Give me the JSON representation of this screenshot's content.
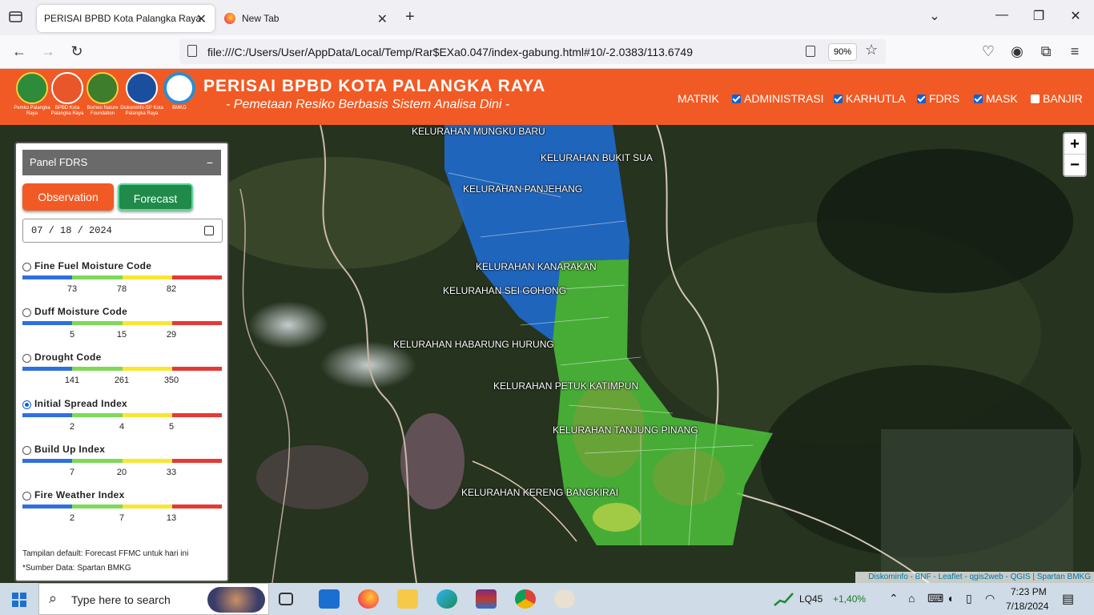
{
  "browser": {
    "tabs": [
      {
        "label": "PERISAI BPBD Kota Palangka Raya",
        "active": true
      },
      {
        "label": "New Tab",
        "active": false
      }
    ],
    "url": "file:///C:/Users/User/AppData/Local/Temp/Rar$EXa0.047/index-gabung.html#10/-2.0383/113.6749",
    "zoom": "90%"
  },
  "header": {
    "title": "PERISAI BPBD KOTA PALANGKA RAYA",
    "subtitle": "- Pemetaan Resiko Berbasis Sistem Analisa Dini -",
    "logos": [
      {
        "caption": "Pemko Palangka Raya",
        "color": "#2e8b3a"
      },
      {
        "caption": "BPBD Kota Palangka Raya",
        "color": "#e8562a"
      },
      {
        "caption": "Borneo Nature Foundation",
        "color": "#3e7d2b"
      },
      {
        "caption": "Diskominfo-SP Kota Palangka Raya",
        "color": "#1a4fa0"
      },
      {
        "caption": "BMKG",
        "color": "#2a8fd0"
      }
    ],
    "menu": [
      {
        "label": "MATRIK",
        "checkbox": false
      },
      {
        "label": "ADMINISTRASI",
        "checkbox": true,
        "checked": true
      },
      {
        "label": "KARHUTLA",
        "checkbox": true,
        "checked": true
      },
      {
        "label": "FDRS",
        "checkbox": true,
        "checked": true
      },
      {
        "label": "MASK",
        "checkbox": true,
        "checked": true
      },
      {
        "label": "BANJIR",
        "checkbox": true,
        "checked": false
      }
    ]
  },
  "map": {
    "kelurahan": [
      "KELURAHAN MUNGKU BARU",
      "KELURAHAN BUKIT SUA",
      "KELURAHAN PANJEHANG",
      "KELURAHAN KANARAKAN",
      "KELURAHAN SEI GOHONG",
      "KELURAHAN HABARUNG HURUNG",
      "KELURAHAN PETUK KATIMPUN",
      "KELURAHAN TANJUNG PINANG",
      "KELURAHAN KERENG BANGKIRAI"
    ],
    "zoom_in": "+",
    "zoom_out": "−",
    "attribution": "Diskominfo - BNF - Leaflet - qgis2web - QGIS | Spartan BMKG"
  },
  "panel": {
    "title": "Panel FDRS",
    "minimize": "−",
    "observation_label": "Observation",
    "forecast_label": "Forecast",
    "date": "07 / 18 / 2024",
    "scale_colors": [
      "#2f6fe0",
      "#7ed957",
      "#f7e733",
      "#e53935"
    ],
    "indices": [
      {
        "label": "Fine Fuel Moisture Code",
        "ticks": [
          "73",
          "78",
          "82"
        ],
        "selected": false
      },
      {
        "label": "Duff Moisture Code",
        "ticks": [
          "5",
          "15",
          "29"
        ],
        "selected": false
      },
      {
        "label": "Drought Code",
        "ticks": [
          "141",
          "261",
          "350"
        ],
        "selected": false
      },
      {
        "label": "Initial Spread Index",
        "ticks": [
          "2",
          "4",
          "5"
        ],
        "selected": true
      },
      {
        "label": "Build Up Index",
        "ticks": [
          "7",
          "20",
          "33"
        ],
        "selected": false
      },
      {
        "label": "Fire Weather Index",
        "ticks": [
          "2",
          "7",
          "13"
        ],
        "selected": false
      }
    ],
    "note_default": "Tampilan default: Forecast FFMC untuk hari ini",
    "note_source": "*Sumber Data: Spartan BMKG"
  },
  "taskbar": {
    "search_placeholder": "Type here to search",
    "stock_name": "LQ45",
    "stock_change": "+1,40%",
    "time": "7:23 PM",
    "date": "7/18/2024"
  }
}
